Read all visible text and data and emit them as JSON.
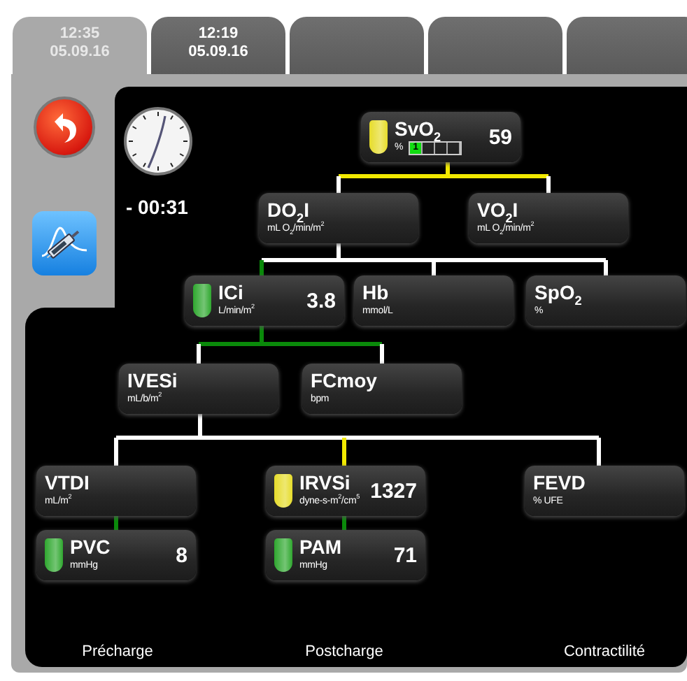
{
  "tabs": [
    {
      "time": "12:35",
      "date": "05.09.16",
      "selected": true
    },
    {
      "time": "12:19",
      "date": "05.09.16",
      "selected": false
    },
    {
      "selected": false
    },
    {
      "selected": false
    },
    {
      "selected": false
    }
  ],
  "timer": "- 00:31",
  "nodes": [
    {
      "name": "SvO$_{2}$",
      "unit": "%",
      "value": "59",
      "color": "#e6dc2a",
      "quality": "1"
    },
    {
      "name": "DO$_{2}$I",
      "unit": "mL O$_{2}$/min/m$^{2}$"
    },
    {
      "name": "VO$_{2}$I",
      "unit": "mL O$_{2}$/min/m$^{2}$"
    },
    {
      "name": "ICi",
      "unit": "L/min/m$^{2}$",
      "value": "3.8",
      "color": "#2fa82f"
    },
    {
      "name": "Hb",
      "unit": "mmol/L"
    },
    {
      "name": "SpO$_{2}$",
      "unit": "%"
    },
    {
      "name": "IVESi",
      "unit": "mL/b/m$^{2}$"
    },
    {
      "name": "FCmoy",
      "unit": "bpm"
    },
    {
      "name": "VTDI",
      "unit": "mL/m$^{2}$"
    },
    {
      "name": "IRVSi",
      "unit": "dyne-s-m$^{2}$/cm$^{5}$",
      "value": "1327",
      "color": "#e6dc2a"
    },
    {
      "name": "FEVD",
      "unit": "% UFE"
    },
    {
      "name": "PVC",
      "unit": "mmHg",
      "value": "8",
      "color": "#2fa82f"
    },
    {
      "name": "PAM",
      "unit": "mmHg",
      "value": "71",
      "color": "#2fa82f"
    }
  ],
  "categories": [
    "Précharge",
    "Postcharge",
    "Contractilité"
  ]
}
